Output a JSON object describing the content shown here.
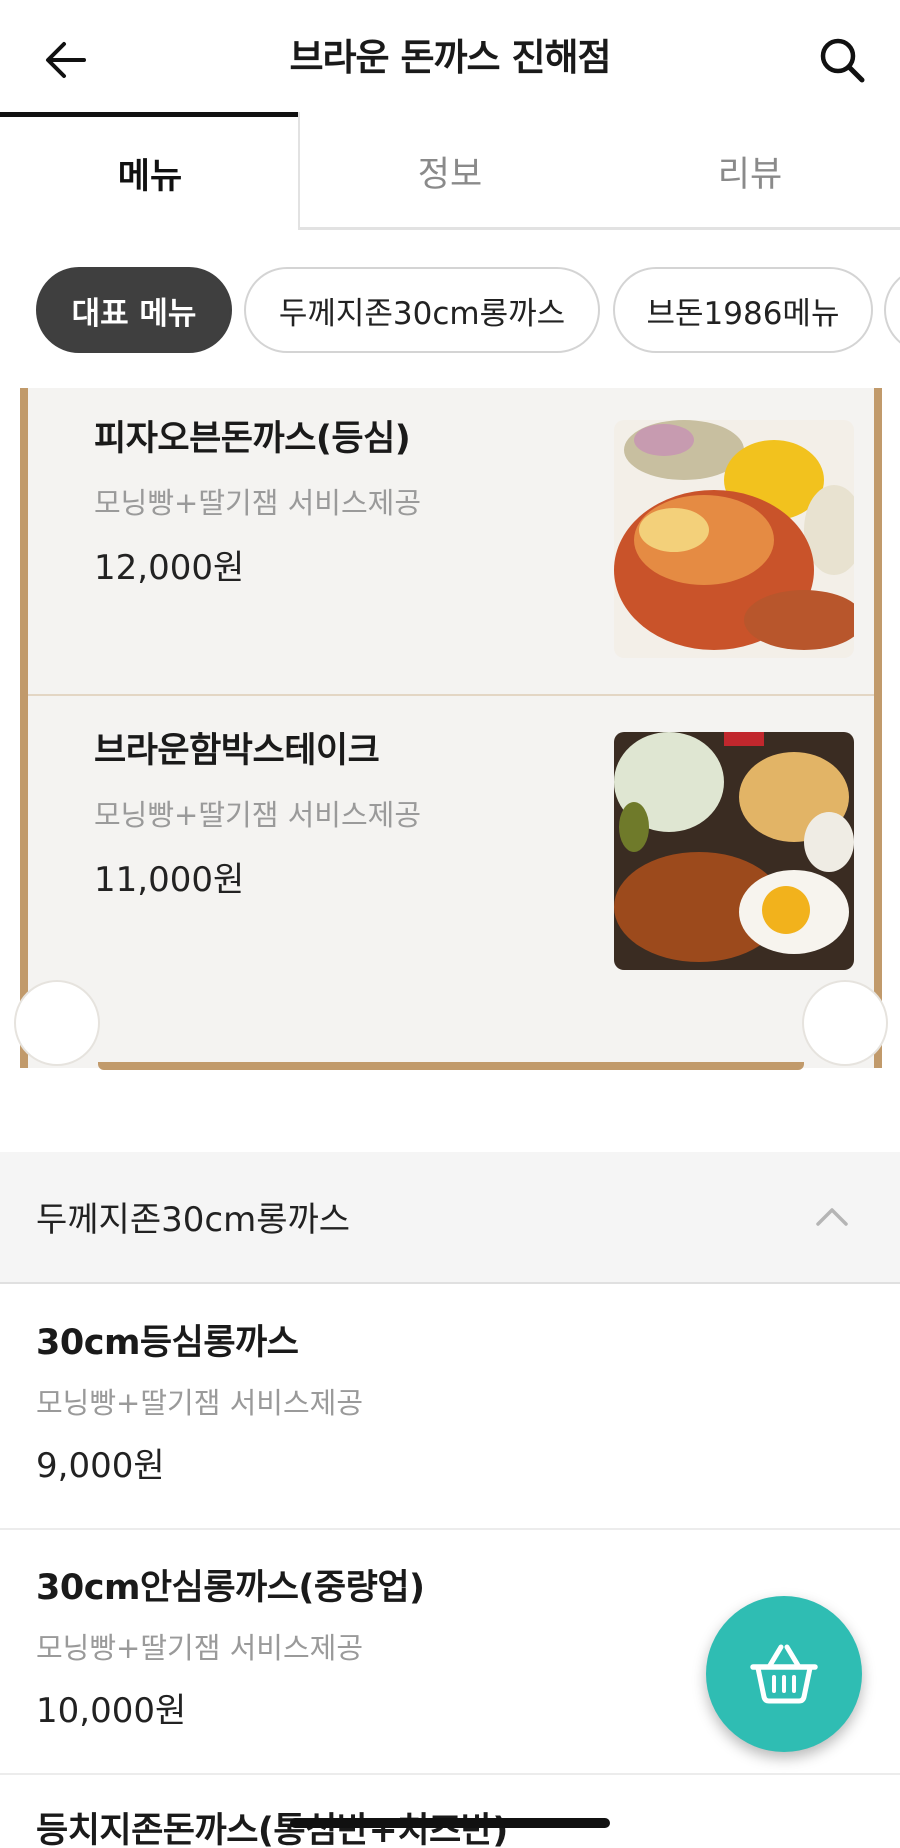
{
  "header": {
    "title": "브라운 돈까스 진해점",
    "back_icon": "arrow-left-icon",
    "search_icon": "search-icon"
  },
  "tabs": [
    {
      "label": "메뉴",
      "active": true
    },
    {
      "label": "정보",
      "active": false
    },
    {
      "label": "리뷰",
      "active": false
    }
  ],
  "chips": [
    {
      "label": "대표 메뉴",
      "active": true
    },
    {
      "label": "두께지존30cm롱까스",
      "active": false
    },
    {
      "label": "브돈1986메뉴",
      "active": false
    }
  ],
  "featured": {
    "items": [
      {
        "name": "피자오븐돈까스(등심)",
        "desc": "모닝빵+딸기잼 서비스제공",
        "price": "12,000원",
        "image": "pizza-oven-pork-cutlet-photo"
      },
      {
        "name": "브라운함박스테이크",
        "desc": "모닝빵+딸기잼 서비스제공",
        "price": "11,000원",
        "image": "hamburg-steak-photo"
      }
    ]
  },
  "section": {
    "title": "두께지존30cm롱까스",
    "collapse_icon": "chevron-up-icon",
    "items": [
      {
        "name": "30cm등심롱까스",
        "desc": "모닝빵+딸기잼 서비스제공",
        "price": "9,000원"
      },
      {
        "name": "30cm안심롱까스(중량업)",
        "desc": "모닝빵+딸기잼 서비스제공",
        "price": "10,000원"
      },
      {
        "name": "등치지존돈까스(통심반+치즈반)",
        "desc": "",
        "price": ""
      }
    ]
  },
  "fab": {
    "icon": "basket-icon"
  },
  "colors": {
    "accent": "#2fbdb3",
    "frame": "#c19a6b",
    "chip_active": "#3f3f3f"
  }
}
